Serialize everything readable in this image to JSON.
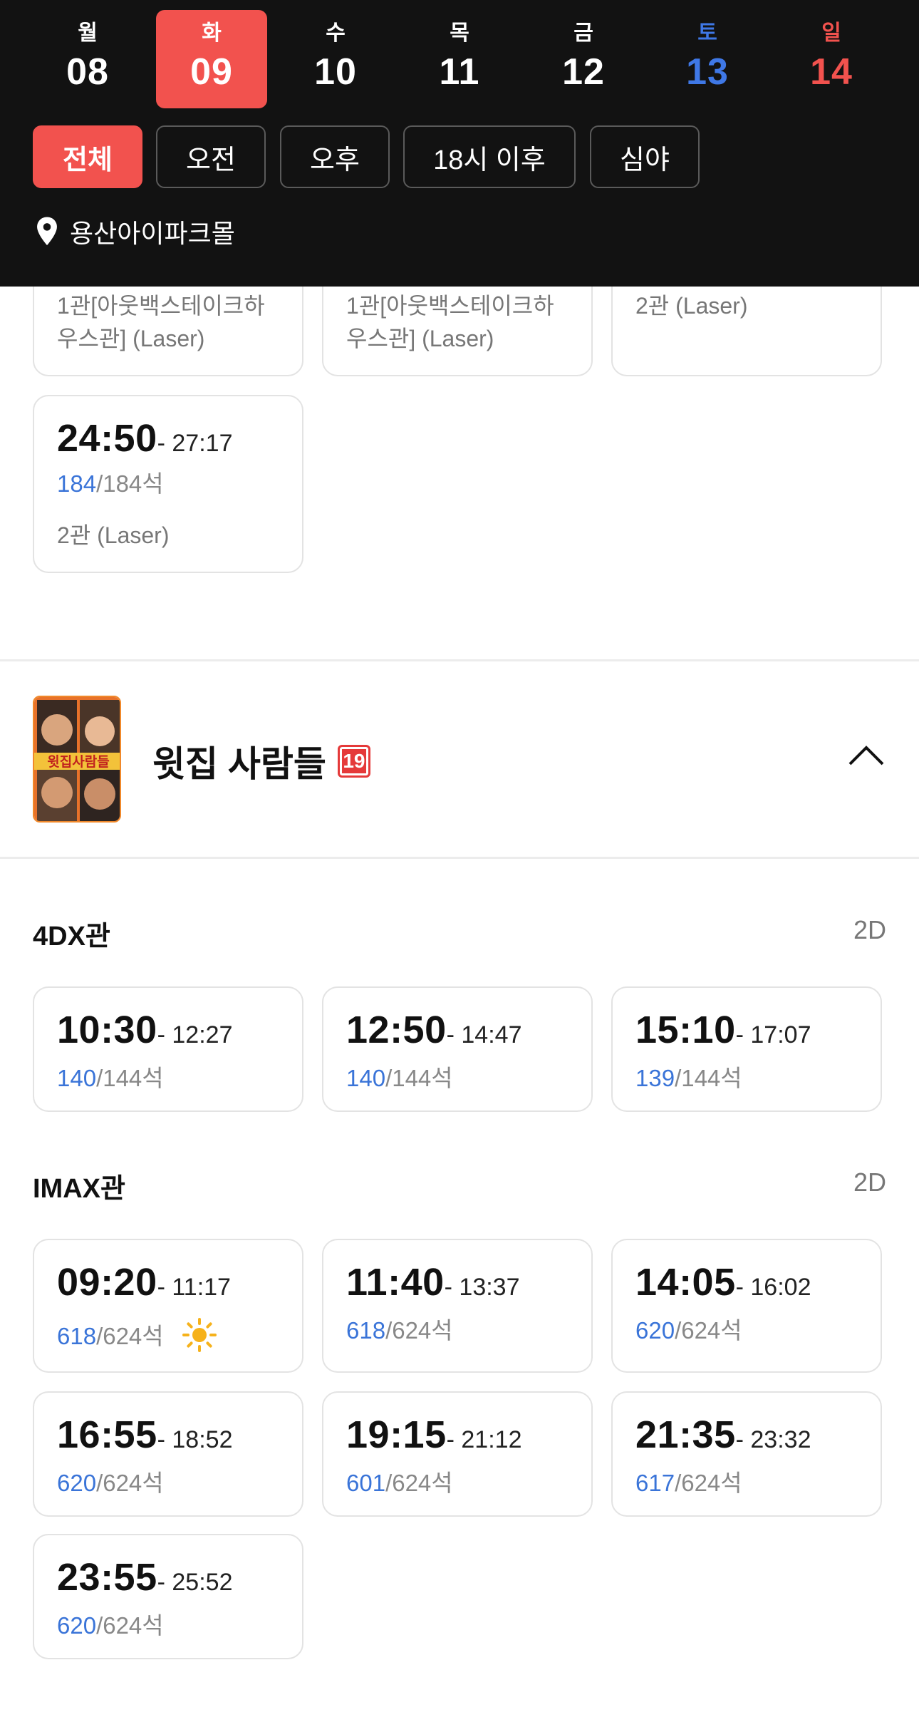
{
  "dates": [
    {
      "dow": "월",
      "num": "08"
    },
    {
      "dow": "화",
      "num": "09"
    },
    {
      "dow": "수",
      "num": "10"
    },
    {
      "dow": "목",
      "num": "11"
    },
    {
      "dow": "금",
      "num": "12"
    },
    {
      "dow": "토",
      "num": "13"
    },
    {
      "dow": "일",
      "num": "14"
    }
  ],
  "selected_date_index": 1,
  "filters": [
    "전체",
    "오전",
    "오후",
    "18시 이후",
    "심야"
  ],
  "active_filter_index": 0,
  "location": "용산아이파크몰",
  "prev_showtimes": [
    {
      "hall": "1관[아웃백스테이크하우스관] (Laser)",
      "hall_line1": "1관[아웃백스테이크하",
      "hall_line2": "우스관] (Laser)"
    },
    {
      "hall": "1관[아웃백스테이크하우스관] (Laser)",
      "hall_line1": "1관[아웃백스테이크하",
      "hall_line2": "우스관] (Laser)"
    },
    {
      "hall": "2관 (Laser)"
    },
    {
      "start": "24:50",
      "end": "- 27:17",
      "available": "184",
      "total": "/184석",
      "hall": "2관 (Laser)"
    }
  ],
  "movie": {
    "title": "윗집 사람들",
    "rating": "19",
    "poster_title": "윗집사람들"
  },
  "groups": [
    {
      "name": "4DX관",
      "format": "2D",
      "showtimes": [
        {
          "start": "10:30",
          "end": "- 12:27",
          "available": "140",
          "total": "/144석"
        },
        {
          "start": "12:50",
          "end": "- 14:47",
          "available": "140",
          "total": "/144석"
        },
        {
          "start": "15:10",
          "end": "- 17:07",
          "available": "139",
          "total": "/144석"
        }
      ]
    },
    {
      "name": "IMAX관",
      "format": "2D",
      "showtimes": [
        {
          "start": "09:20",
          "end": "- 11:17",
          "available": "618",
          "total": "/624석",
          "icon": "sun-icon"
        },
        {
          "start": "11:40",
          "end": "- 13:37",
          "available": "618",
          "total": "/624석"
        },
        {
          "start": "14:05",
          "end": "- 16:02",
          "available": "620",
          "total": "/624석"
        },
        {
          "start": "16:55",
          "end": "- 18:52",
          "available": "620",
          "total": "/624석"
        },
        {
          "start": "19:15",
          "end": "- 21:12",
          "available": "601",
          "total": "/624석"
        },
        {
          "start": "21:35",
          "end": "- 23:32",
          "available": "617",
          "total": "/624석"
        },
        {
          "start": "23:55",
          "end": "- 25:52",
          "available": "620",
          "total": "/624석"
        }
      ]
    }
  ],
  "colors": {
    "accent": "#f2524e",
    "header_bg": "#121212",
    "seat_available": "#3a74d8",
    "saturday": "#3f78e6",
    "sunday": "#f2524e"
  }
}
